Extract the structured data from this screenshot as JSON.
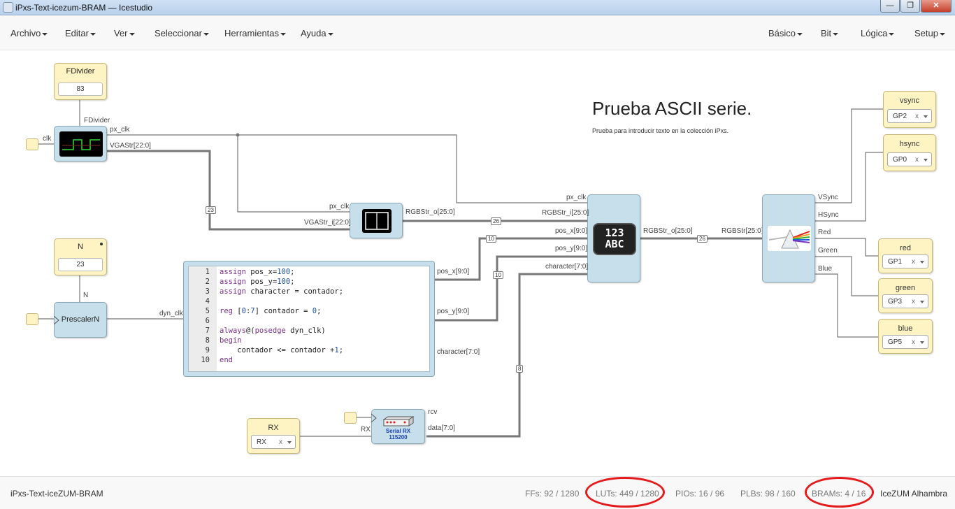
{
  "window": {
    "title": "iPxs-Text-icezum-BRAM — Icestudio",
    "min": "—",
    "max": "❐",
    "close": "✕"
  },
  "menu_left": [
    "Archivo",
    "Editar",
    "Ver",
    "Seleccionar",
    "Herramientas",
    "Ayuda"
  ],
  "menu_right": [
    "Básico",
    "Bit",
    "Lógica",
    "Setup"
  ],
  "canvas": {
    "heading": "Prueba ASCII serie.",
    "description": "Prueba para introducir texto en la colección iPxs.",
    "fdivider": {
      "name": "FDivider",
      "value": "83"
    },
    "n_const": {
      "name": "N",
      "value": "23"
    },
    "rx_pin": {
      "name": "RX",
      "value": "RX"
    },
    "vsync_pin": {
      "name": "vsync",
      "value": "GP2"
    },
    "hsync_pin": {
      "name": "hsync",
      "value": "GP0"
    },
    "red_pin": {
      "name": "red",
      "value": "GP1"
    },
    "green_pin": {
      "name": "green",
      "value": "GP3"
    },
    "blue_pin": {
      "name": "blue",
      "value": "GP5"
    },
    "prescaler": {
      "name": "PrescalerN"
    },
    "serial": {
      "line1": "Serial RX",
      "line2": "115200"
    },
    "ascii_icon": {
      "line1": "123",
      "line2": "ABC"
    },
    "labels": {
      "fdivider_port": "FDivider",
      "clk": "clk",
      "px_clk": "px_clk",
      "vgastr": "VGAStr[22:0]",
      "n_port": "N",
      "dyn_clk": "dyn_clk",
      "px_clk_in": "px_clk",
      "vgastr_in": "VGAStr_i[22:0]",
      "rgbstr_out": "RGBStr_o[25:0]",
      "px_clk_in2": "px_clk",
      "rgbstr_in": "RGBStr_i[25:0]",
      "pos_x_in": "pos_x[9:0]",
      "pos_y_in": "pos_y[9:0]",
      "character_in": "character[7:0]",
      "rgbstr_out2": "RGBStr_o[25:0]",
      "rgbstr_in2": "RGBStr[25:0]",
      "vsync": "VSync",
      "hsync": "HSync",
      "red": "Red",
      "green": "Green",
      "blue": "Blue",
      "pos_x_out": "pos_x[9:0]",
      "pos_y_out": "pos_y[9:0]",
      "character_out": "character[7:0]",
      "rx_port": "RX",
      "rcv": "rcv",
      "data": "data[7:0]"
    },
    "bus_widths": {
      "w23": "23",
      "w26a": "26",
      "w26b": "26",
      "w10a": "10",
      "w10b": "10",
      "w8": "8"
    }
  },
  "code": [
    {
      "n": "1",
      "t": "assign pos_x=100;"
    },
    {
      "n": "2",
      "t": "assign pos_y=100;"
    },
    {
      "n": "3",
      "t": "assign character = contador;"
    },
    {
      "n": "4",
      "t": ""
    },
    {
      "n": "5",
      "t": "reg [0:7] contador = 0;"
    },
    {
      "n": "6",
      "t": ""
    },
    {
      "n": "7",
      "t": "always@(posedge dyn_clk)"
    },
    {
      "n": "8",
      "t": "begin"
    },
    {
      "n": "9",
      "t": "    contador <= contador +1;"
    },
    {
      "n": "10",
      "t": "end"
    }
  ],
  "status": {
    "project": "iPxs-Text-iceZUM-BRAM",
    "ffs": "FFs:  92 / 1280",
    "luts": "LUTs:  449 / 1280",
    "pios": "PIOs:  16 / 96",
    "plbs": "PLBs:  98 / 160",
    "brams": "BRAMs:  4 / 16",
    "board": "IceZUM Alhambra"
  },
  "colors": {
    "block": "#c6dfea",
    "constant": "#fdf3c3",
    "wire": "#777777",
    "highlight": "#e41a1c"
  }
}
